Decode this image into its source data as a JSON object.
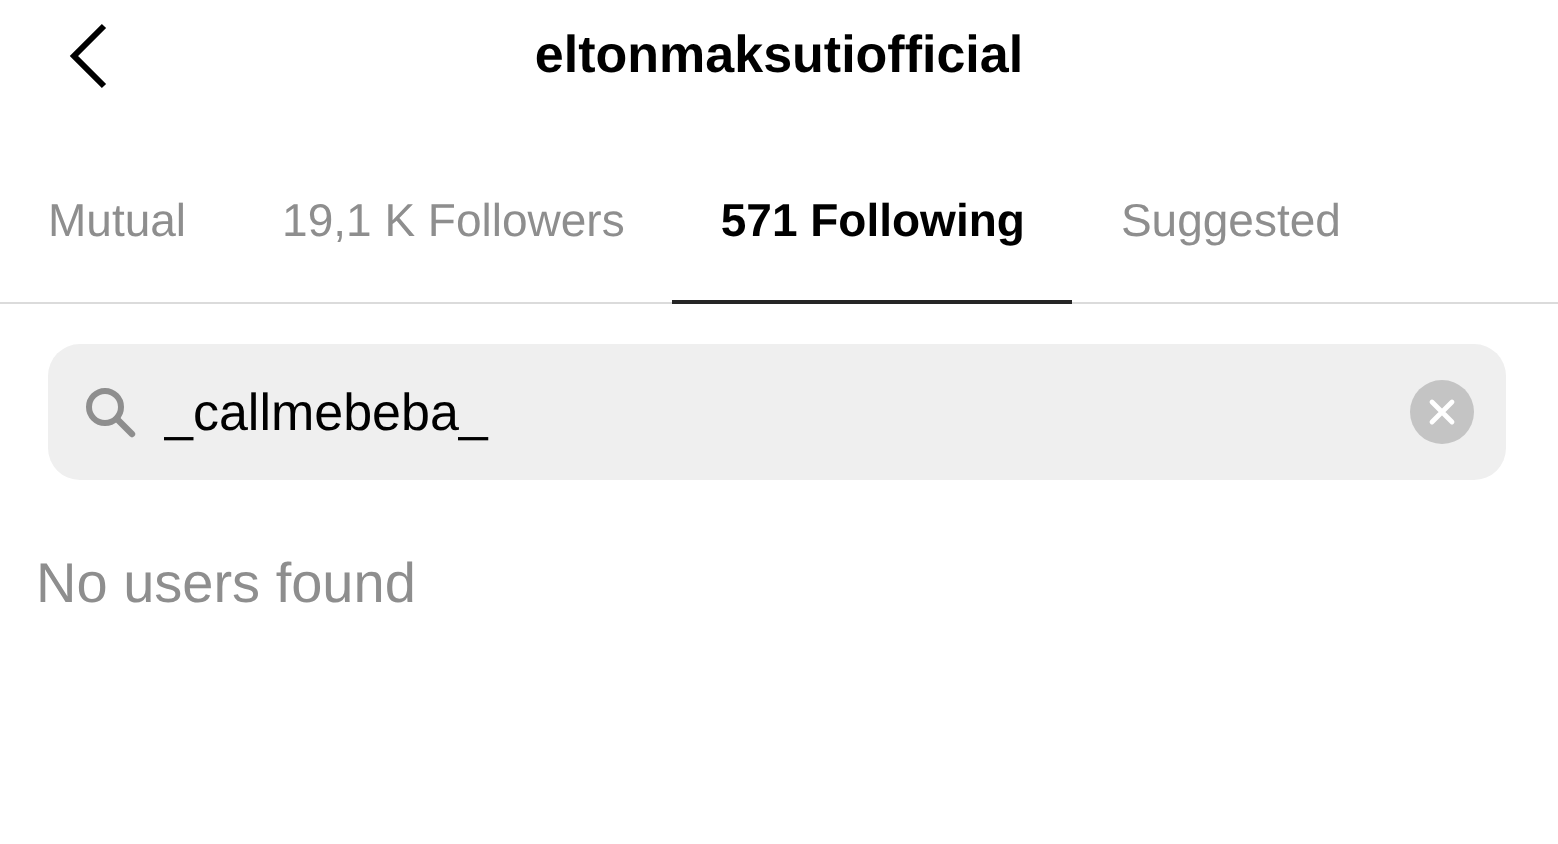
{
  "header": {
    "title": "eltonmaksutiofficial"
  },
  "tabs": [
    {
      "label": "Mutual",
      "selected": false
    },
    {
      "label": "19,1 K Followers",
      "selected": false
    },
    {
      "label": "571 Following",
      "selected": true
    },
    {
      "label": "Suggested",
      "selected": false
    }
  ],
  "search": {
    "value": "_callmebeba_"
  },
  "message": "No users found"
}
